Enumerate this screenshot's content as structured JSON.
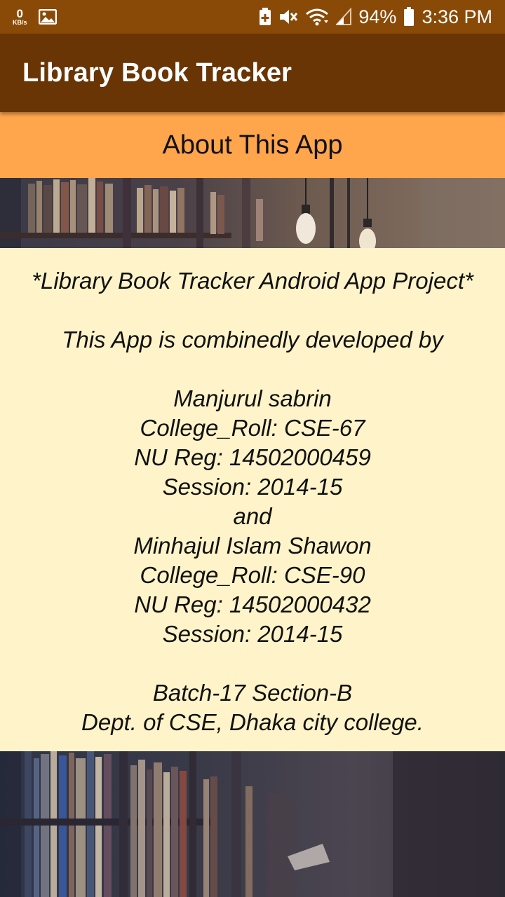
{
  "status_bar": {
    "kbs_value": "0",
    "kbs_unit": "KB/s",
    "battery_percent": "94%",
    "time": "3:36 PM",
    "icons": [
      "image-icon",
      "battery-saver-icon",
      "mute-icon",
      "wifi-icon",
      "signal-icon",
      "battery-icon"
    ]
  },
  "app_bar": {
    "title": "Library Book Tracker"
  },
  "section": {
    "title": "About This App"
  },
  "about": {
    "heading": "*Library Book Tracker Android App Project*",
    "intro": "This App is combinedly developed by",
    "dev1_name": "Manjurul sabrin",
    "dev1_roll": "College_Roll: CSE-67",
    "dev1_reg": "NU Reg: 14502000459",
    "dev1_session": "Session: 2014-15",
    "conjunction": "and",
    "dev2_name": "Minhajul Islam Shawon",
    "dev2_roll": "College_Roll: CSE-90",
    "dev2_reg": "NU Reg: 14502000432",
    "dev2_session": "Session: 2014-15",
    "batch": "Batch-17 Section-B",
    "dept": "Dept. of CSE, Dhaka city college."
  },
  "colors": {
    "status_bar": "#8a4a07",
    "app_bar": "#693505",
    "section_header": "#ffa64d",
    "content_bg": "#fff4c9"
  }
}
